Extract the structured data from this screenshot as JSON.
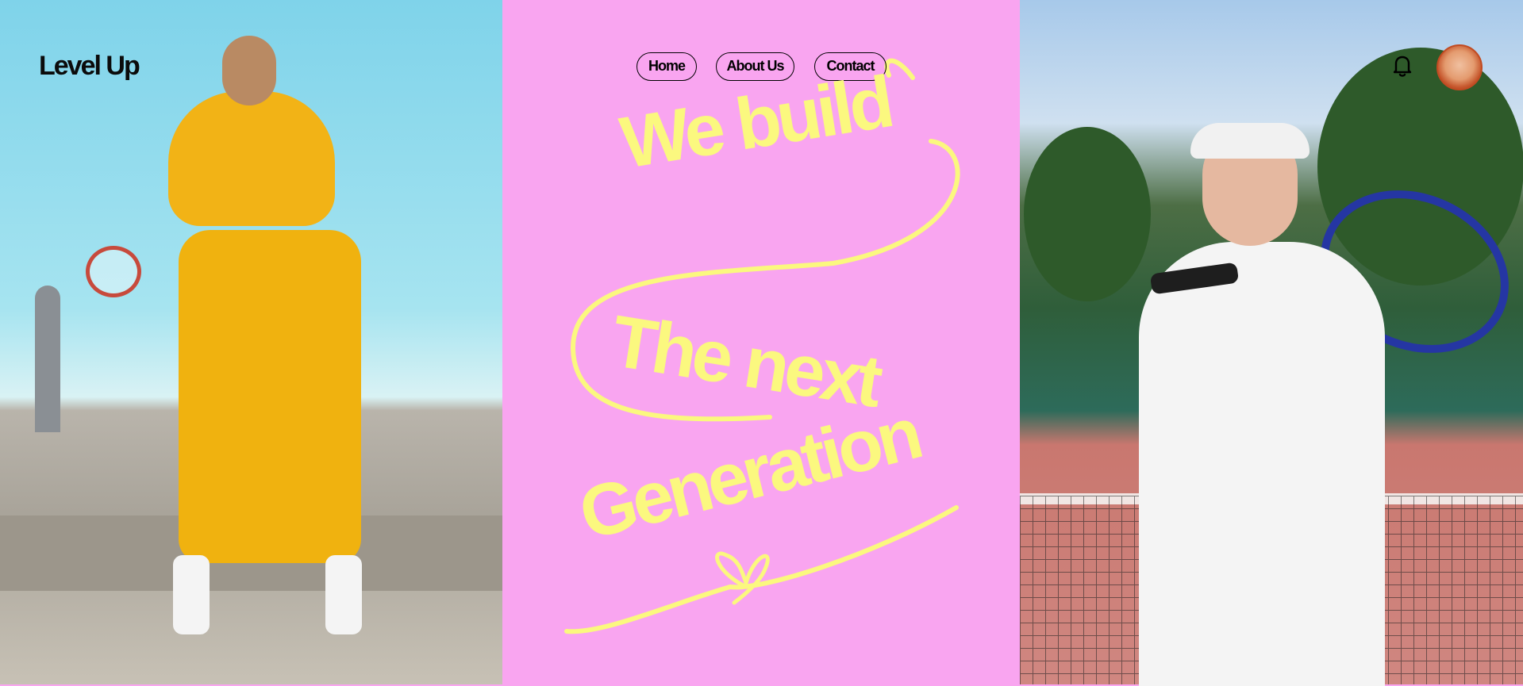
{
  "brand": {
    "logo_text": "Level Up"
  },
  "nav": {
    "items": [
      {
        "label": "Home"
      },
      {
        "label": "About Us"
      },
      {
        "label": "Contact"
      }
    ]
  },
  "hero": {
    "line1": "We build",
    "line2": "The next",
    "line3": "Generation"
  },
  "header_right": {
    "bell_icon": "bell-icon",
    "avatar": "user-avatar"
  },
  "colors": {
    "background_center": "#f9a5f0",
    "accent_yellow": "#fbf87f",
    "text_dark": "#0b0b0b"
  }
}
